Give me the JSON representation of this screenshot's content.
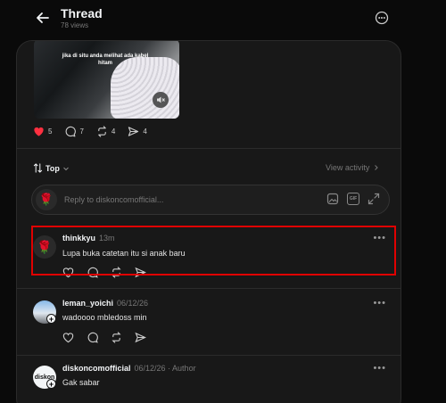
{
  "header": {
    "title": "Thread",
    "views": "78 views"
  },
  "video": {
    "caption": "jika di situ anda melihat ada kabel hitam"
  },
  "stats": [
    {
      "icon": "heart-icon",
      "count": "5"
    },
    {
      "icon": "comment-icon",
      "count": "7"
    },
    {
      "icon": "repost-icon",
      "count": "4"
    },
    {
      "icon": "share-icon",
      "count": "4"
    }
  ],
  "sort": {
    "label": "Top",
    "view_activity": "View activity"
  },
  "reply": {
    "placeholder": "Reply to diskoncomofficial..."
  },
  "comments": [
    {
      "username": "thinkkyu",
      "meta": "13m",
      "text": "Lupa buka catetan itu si anak baru",
      "avatar": "🌹"
    },
    {
      "username": "leman_yoichi",
      "meta": "06/12/26",
      "text": "wadoooo mbledoss min",
      "avatar": ""
    },
    {
      "username": "diskoncomofficial",
      "meta": "06/12/26 · Author",
      "text": "Gak sabar",
      "avatar": "diskon"
    }
  ],
  "colors": {
    "accent_heart": "#ff3040",
    "highlight": "#e00000"
  }
}
